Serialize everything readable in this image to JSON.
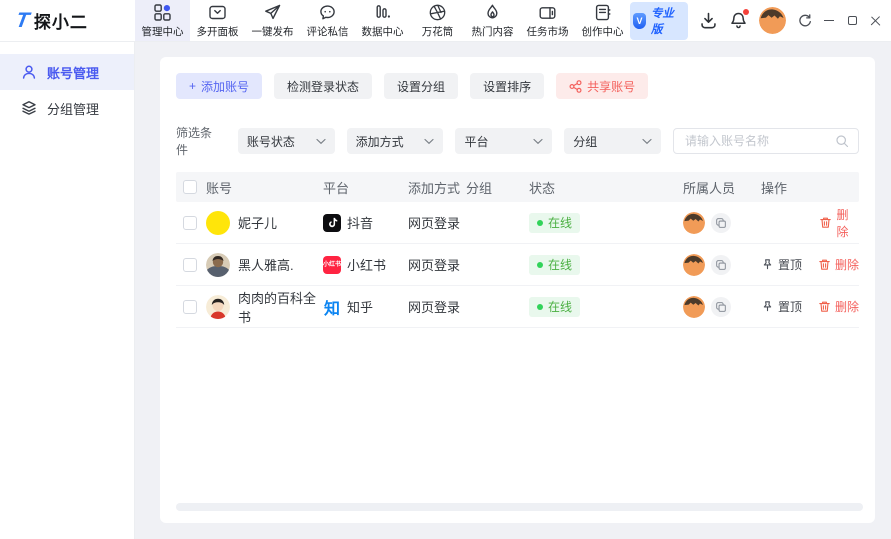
{
  "colors": {
    "accent": "#5565f1",
    "danger": "#f4605c",
    "success": "#4cb043",
    "pro_blue": "#1f62ff",
    "xhs_red": "#ff2442",
    "zhihu_blue": "#0c85f2"
  },
  "logo": {
    "icon_text": "T",
    "text": "探小二"
  },
  "topnav": {
    "items": [
      {
        "label": "管理中心",
        "icon": "dashboard-grid-icon",
        "active": true
      },
      {
        "label": "多开面板",
        "icon": "multi-panel-icon",
        "active": false
      },
      {
        "label": "一键发布",
        "icon": "paper-plane-icon",
        "active": false
      },
      {
        "label": "评论私信",
        "icon": "chat-bubble-icon",
        "active": false
      },
      {
        "label": "数据中心",
        "icon": "bar-chart-icon",
        "active": false
      },
      {
        "label": "万花筒",
        "icon": "aperture-icon",
        "active": false
      },
      {
        "label": "热门内容",
        "icon": "flame-icon",
        "active": false
      },
      {
        "label": "任务市场",
        "icon": "market-box-icon",
        "active": false
      },
      {
        "label": "创作中心",
        "icon": "create-doc-icon",
        "active": false
      }
    ]
  },
  "topbar_right": {
    "pro_badge_v": "V",
    "pro_badge": "专业版"
  },
  "sidebar": {
    "items": [
      {
        "label": "账号管理",
        "icon": "person-icon",
        "active": true
      },
      {
        "label": "分组管理",
        "icon": "layers-icon",
        "active": false
      }
    ]
  },
  "toolbar": {
    "add_plus": "+",
    "add": "添加账号",
    "check_login": "检测登录状态",
    "set_group": "设置分组",
    "set_order": "设置排序",
    "share": "共享账号"
  },
  "filters": {
    "label": "筛选条件",
    "dropdowns": [
      {
        "value": "账号状态"
      },
      {
        "value": "添加方式"
      },
      {
        "value": "平台"
      },
      {
        "value": "分组"
      }
    ],
    "search_placeholder": "请输入账号名称"
  },
  "table": {
    "headers": [
      "账号",
      "平台",
      "添加方式",
      "分组",
      "状态",
      "所属人员",
      "操作"
    ],
    "labels": {
      "pin": "置顶",
      "delete": "删除"
    },
    "rows": [
      {
        "name": "妮子儿",
        "platform": "抖音",
        "platform_icon": "douyin-icon",
        "method": "网页登录",
        "group": "",
        "status": "在线",
        "has_pin": false
      },
      {
        "name": "黑人雅高.",
        "platform": "小红书",
        "platform_icon": "xiaohongshu-icon",
        "platform_icon_text": "小红书",
        "method": "网页登录",
        "group": "",
        "status": "在线",
        "has_pin": true
      },
      {
        "name": "肉肉的百科全书",
        "platform": "知乎",
        "platform_icon": "zhihu-icon",
        "platform_icon_glyph": "知",
        "method": "网页登录",
        "group": "",
        "status": "在线",
        "has_pin": true
      }
    ]
  }
}
